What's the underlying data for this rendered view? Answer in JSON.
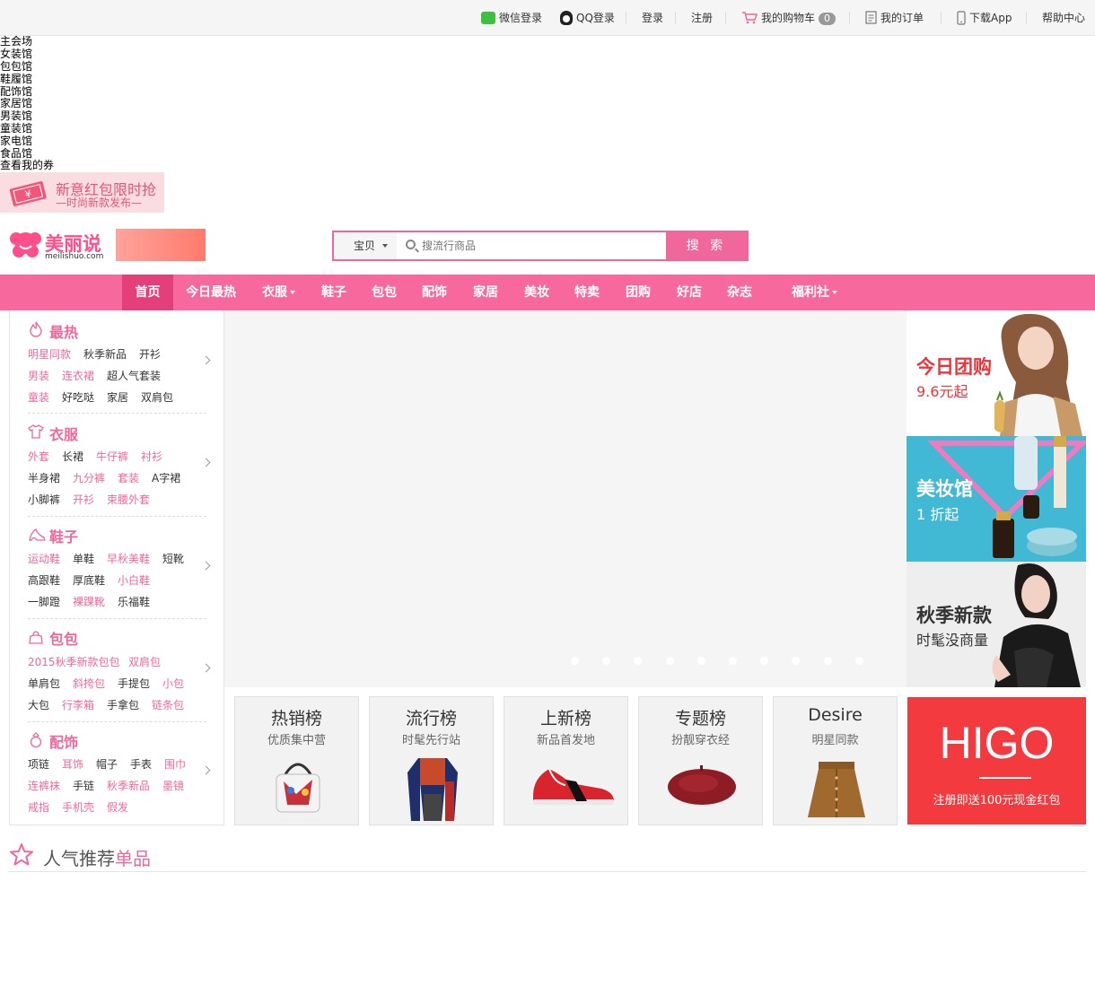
{
  "topbar": {
    "wechat_login": "微信登录",
    "qq_login": "QQ登录",
    "login": "登录",
    "register": "注册",
    "cart": "我的购物车",
    "cart_count": "0",
    "orders": "我的订单",
    "download_app": "下载App",
    "help": "帮助中心"
  },
  "venues": [
    "主会场",
    "女装馆",
    "包包馆",
    "鞋履馆",
    "配饰馆",
    "家居馆",
    "男装馆",
    "童装馆",
    "家电馆",
    "食品馆",
    "查看我的券"
  ],
  "promo": {
    "line1": "新意红包限时抢",
    "line2": "—时尚新款发布—"
  },
  "logo": {
    "cn": "美丽说",
    "en": "meilishuo.com"
  },
  "search": {
    "category": "宝贝",
    "placeholder": "搜流行商品",
    "button": "搜 索"
  },
  "nav": [
    {
      "label": "首页"
    },
    {
      "label": "今日最热"
    },
    {
      "label": "衣服"
    },
    {
      "label": "鞋子"
    },
    {
      "label": "包包"
    },
    {
      "label": "配饰"
    },
    {
      "label": "家居"
    },
    {
      "label": "美妆"
    },
    {
      "label": "特卖"
    },
    {
      "label": "团购"
    },
    {
      "label": "好店"
    },
    {
      "label": "杂志"
    },
    {
      "label": "福利社"
    }
  ],
  "side": [
    {
      "title": "最热",
      "rows": [
        [
          "明星同款",
          "秋季新品",
          "开衫"
        ],
        [
          "男装",
          "连衣裙",
          "超人气套装"
        ],
        [
          "童装",
          "好吃哒",
          "家居",
          "双肩包"
        ]
      ]
    },
    {
      "title": "衣服",
      "rows": [
        [
          "外套",
          "长裙",
          "牛仔裤",
          "衬衫"
        ],
        [
          "半身裙",
          "九分裤",
          "套装",
          "A字裙"
        ],
        [
          "小脚裤",
          "开衫",
          "束腰外套"
        ]
      ]
    },
    {
      "title": "鞋子",
      "rows": [
        [
          "运动鞋",
          "单鞋",
          "早秋美鞋",
          "短靴"
        ],
        [
          "高跟鞋",
          "厚底鞋",
          "小白鞋"
        ],
        [
          "一脚蹬",
          "裸踝靴",
          "乐福鞋"
        ]
      ]
    },
    {
      "title": "包包",
      "rows": [
        [
          "2015秋季新款包包",
          "双肩包"
        ],
        [
          "单肩包",
          "斜挎包",
          "手提包",
          "小包"
        ],
        [
          "大包",
          "行李箱",
          "手拿包",
          "链条包"
        ]
      ]
    },
    {
      "title": "配饰",
      "rows": [
        [
          "项链",
          "耳饰",
          "帽子",
          "手表",
          "围巾"
        ],
        [
          "连裤袜",
          "手链",
          "秋季新品",
          "墨镜"
        ],
        [
          "戒指",
          "手机壳",
          "假发"
        ]
      ]
    }
  ],
  "banners": [
    {
      "title": "今日团购",
      "sub": "9.6元起"
    },
    {
      "title": "美妆馆",
      "sub": "1 折起"
    },
    {
      "title": "秋季新款",
      "sub": "时髦没商量"
    }
  ],
  "cards": [
    {
      "title": "热销榜",
      "sub": "优质集中营"
    },
    {
      "title": "流行榜",
      "sub": "时髦先行站"
    },
    {
      "title": "上新榜",
      "sub": "新品首发地"
    },
    {
      "title": "专题榜",
      "sub": "扮靓穿衣经"
    },
    {
      "title": "Desire",
      "sub": "明星同款"
    }
  ],
  "higo": {
    "logo": "HIGO",
    "text": "注册即送100元现金红包"
  },
  "recommend": {
    "title": "人气推荐",
    "highlight": "单品"
  },
  "colors": {
    "brand_pink": "#f7699c",
    "nav_active": "#e33f79",
    "higo_red": "#f33a3f"
  }
}
